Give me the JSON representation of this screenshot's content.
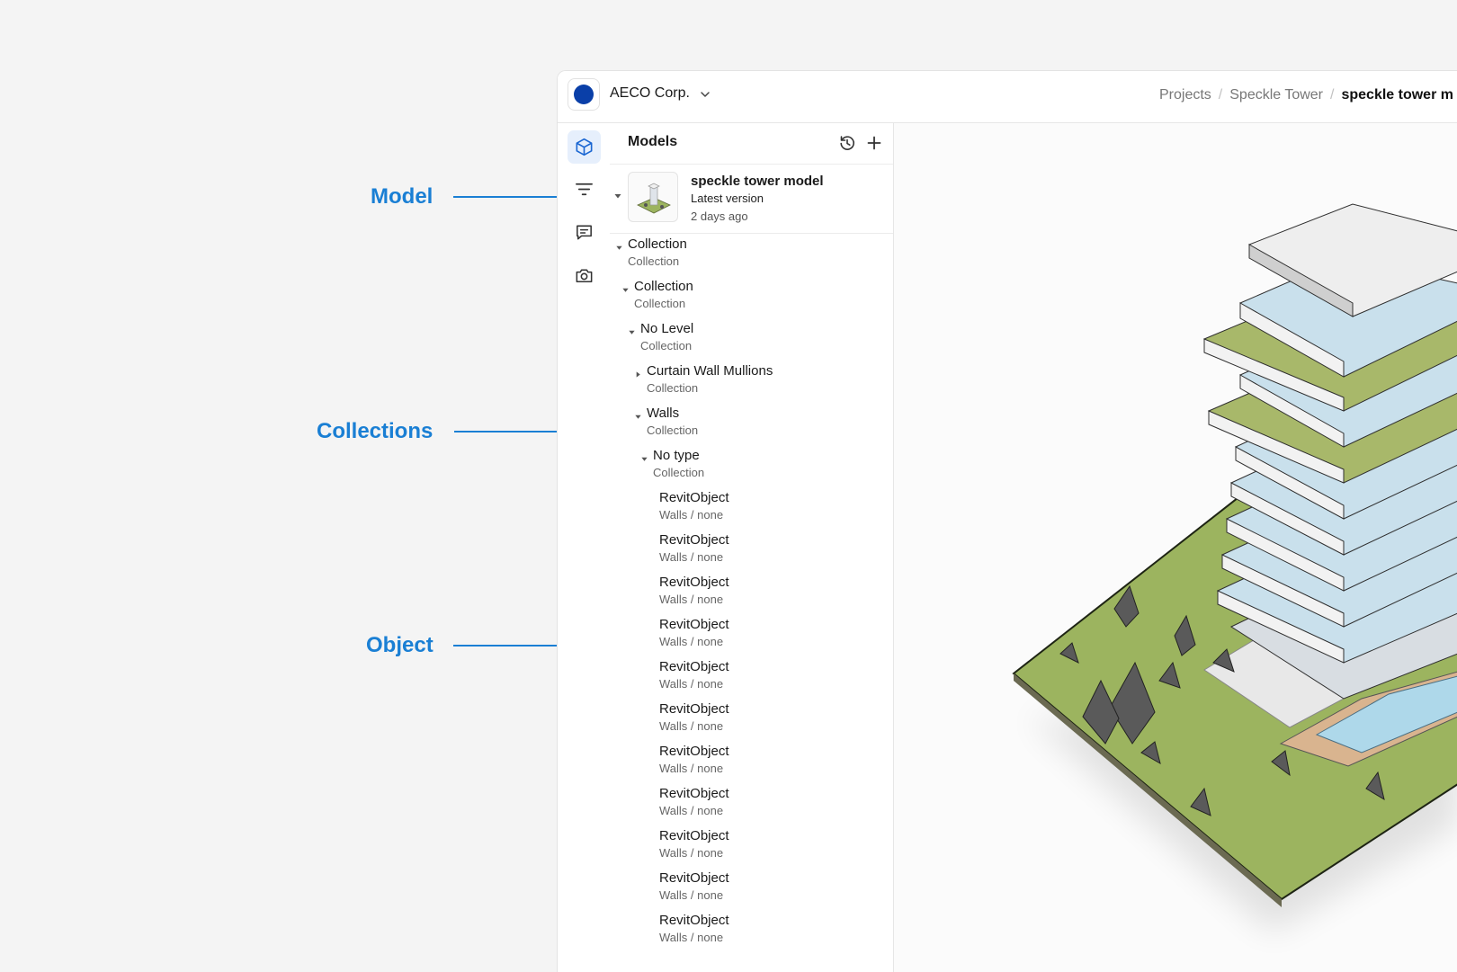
{
  "callouts": {
    "model": "Model",
    "collections": "Collections",
    "object": "Object"
  },
  "header": {
    "workspace_name": "AECO Corp.",
    "breadcrumb": [
      "Projects",
      "Speckle Tower",
      "speckle tower m"
    ]
  },
  "panel": {
    "title": "Models",
    "model": {
      "name": "speckle tower model",
      "version": "Latest version",
      "updated": "2 days ago"
    },
    "tree": [
      {
        "name": "Collection",
        "type": "Collection",
        "caret": "down"
      },
      {
        "name": "Collection",
        "type": "Collection",
        "caret": "down"
      },
      {
        "name": "No Level",
        "type": "Collection",
        "caret": "down"
      },
      {
        "name": "Curtain Wall Mullions",
        "type": "Collection",
        "caret": "right"
      },
      {
        "name": "Walls",
        "type": "Collection",
        "caret": "down"
      },
      {
        "name": "No type",
        "type": "Collection",
        "caret": "down"
      },
      {
        "name": "RevitObject",
        "type": "Walls / none",
        "caret": "none"
      },
      {
        "name": "RevitObject",
        "type": "Walls / none",
        "caret": "none"
      },
      {
        "name": "RevitObject",
        "type": "Walls / none",
        "caret": "none"
      },
      {
        "name": "RevitObject",
        "type": "Walls / none",
        "caret": "none"
      },
      {
        "name": "RevitObject",
        "type": "Walls / none",
        "caret": "none"
      },
      {
        "name": "RevitObject",
        "type": "Walls / none",
        "caret": "none"
      },
      {
        "name": "RevitObject",
        "type": "Walls / none",
        "caret": "none"
      },
      {
        "name": "RevitObject",
        "type": "Walls / none",
        "caret": "none"
      },
      {
        "name": "RevitObject",
        "type": "Walls / none",
        "caret": "none"
      },
      {
        "name": "RevitObject",
        "type": "Walls / none",
        "caret": "none"
      },
      {
        "name": "RevitObject",
        "type": "Walls / none",
        "caret": "none"
      }
    ]
  },
  "icons": {
    "rail": [
      "cube-icon",
      "filter-icon",
      "comment-icon",
      "camera-icon"
    ],
    "header_actions": [
      "history-icon",
      "plus-icon"
    ]
  },
  "colors": {
    "accent": "#1a7fd4",
    "workspace_logo": "#0a3fa8",
    "rail_active_bg": "#e6effc",
    "ground": "#9cb45f",
    "pool": "#aed8ea"
  }
}
